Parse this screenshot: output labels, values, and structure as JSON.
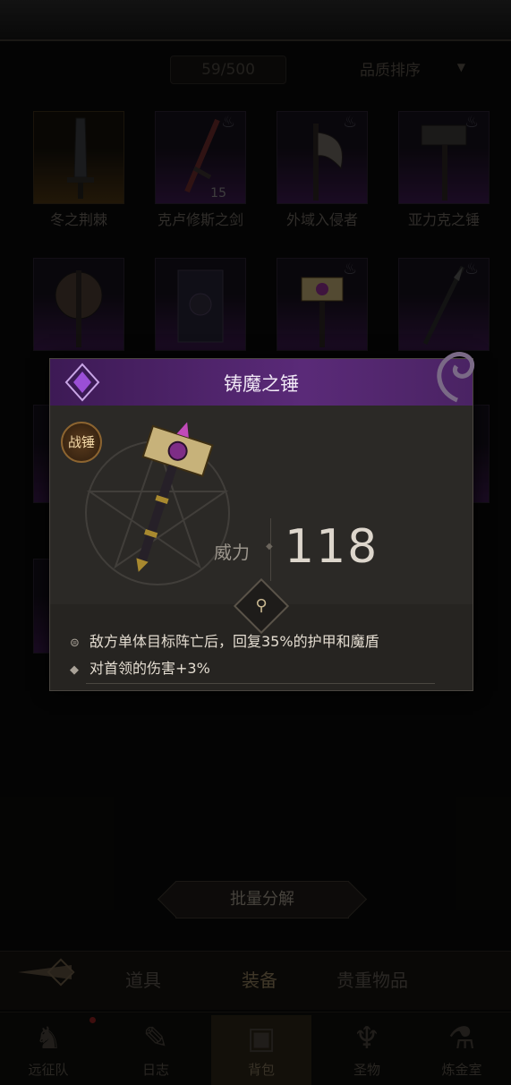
{
  "inventory": {
    "counter": "59/500",
    "sort_label": "品质排序",
    "items": [
      {
        "name": "冬之荆棘",
        "count": ""
      },
      {
        "name": "克卢修斯之剑",
        "count": "15"
      },
      {
        "name": "外域入侵者",
        "count": ""
      },
      {
        "name": "亚力克之锤",
        "count": ""
      },
      {
        "name": "",
        "count": ""
      },
      {
        "name": "",
        "count": ""
      },
      {
        "name": "",
        "count": ""
      },
      {
        "name": "",
        "count": ""
      }
    ]
  },
  "popup": {
    "title": "铸魔之锤",
    "type_badge": "战锤",
    "power_label": "威力",
    "power_value": "118",
    "attributes": [
      {
        "icon": "lock-icon",
        "text": "敌方单体目标阵亡后，回复35%的护甲和魔盾"
      },
      {
        "icon": "diamond-bullet-icon",
        "text": "对首领的伤害+3%"
      }
    ]
  },
  "actions": {
    "batch_label": "批量分解"
  },
  "tabs": [
    {
      "label": "道具",
      "active": false
    },
    {
      "label": "装备",
      "active": true
    },
    {
      "label": "贵重物品",
      "active": false
    }
  ],
  "nav": [
    {
      "label": "远征队",
      "icon": "horned-helmet-icon",
      "active": false
    },
    {
      "label": "日志",
      "icon": "scroll-icon",
      "active": false
    },
    {
      "label": "背包",
      "icon": "backpack-icon",
      "active": true
    },
    {
      "label": "圣物",
      "icon": "torch-icon",
      "active": false
    },
    {
      "label": "炼金室",
      "icon": "alchemy-icon",
      "active": false
    }
  ],
  "colors": {
    "rarity_purple": "#5a2a78",
    "rarity_gold": "#4a3412",
    "background": "#0b0a09"
  }
}
